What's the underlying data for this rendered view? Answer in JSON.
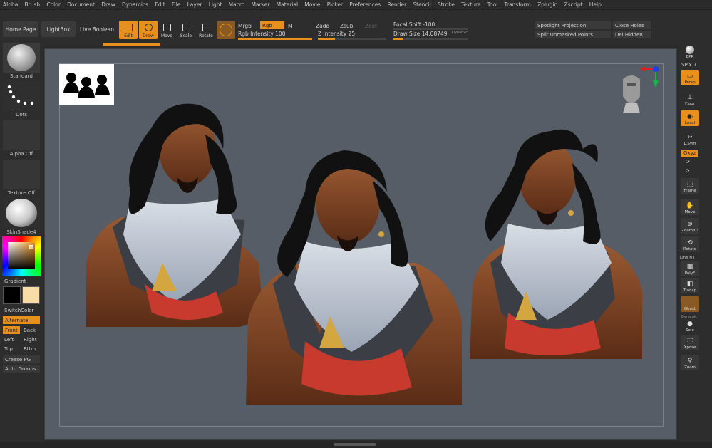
{
  "menu": [
    "Alpha",
    "Brush",
    "Color",
    "Document",
    "Draw",
    "Dynamics",
    "Edit",
    "File",
    "Layer",
    "Light",
    "Macro",
    "Marker",
    "Material",
    "Movie",
    "Picker",
    "Preferences",
    "Render",
    "Stencil",
    "Stroke",
    "Texture",
    "Tool",
    "Transform",
    "Zplugin",
    "Zscript",
    "Help"
  ],
  "toolbar": {
    "home_page": "Home Page",
    "lightbox": "LightBox",
    "live_boolean": "Live Boolean",
    "edit": "Edit",
    "draw": "Draw",
    "move": "Move",
    "scale": "Scale",
    "rotate": "Rotate",
    "mrgb": "Mrgb",
    "rgb": "Rgb",
    "m": "M",
    "rgb_intensity": "Rgb Intensity 100",
    "rgb_intensity_value": 1.0,
    "zadd": "Zadd",
    "zsub": "Zsub",
    "zcut": "Zcut",
    "z_intensity": "Z Intensity 25",
    "z_intensity_value": 0.25,
    "focal_shift": "Focal Shift -100",
    "draw_size": "Draw Size 14.08749",
    "dynamic": "Dynamic",
    "spotlight_projection": "Spotlight Projection",
    "split_unmasked_points": "Split Unmasked Points",
    "close_holes": "Close Holes",
    "del_hidden": "Del Hidden"
  },
  "left": {
    "brush": "Standard",
    "stroke": "Dots",
    "alpha": "Alpha Off",
    "texture": "Texture Off",
    "material": "SkinShade4",
    "gradient": "Gradient",
    "switch_color": "SwitchColor",
    "alternate": "Alternate",
    "front": "Front",
    "back": "Back",
    "left": "Left",
    "right": "Right",
    "top": "Top",
    "bottom": "Bttm",
    "crease_pg": "Crease PG",
    "auto_groups": "Auto Groups",
    "secondary_color": "#f7dca8",
    "primary_color": "#000000"
  },
  "right": {
    "bpr": "BPR",
    "spix": "SPix 7",
    "persp": "Persp",
    "floor": "Floor",
    "local": "Local",
    "lsym": "L.Sym",
    "xyz": "Qxyz",
    "frame": "Frame",
    "move": "Move",
    "zoom3d": "Zoom3D",
    "rotate": "Rotate",
    "line_fill": "Line Fill",
    "polyf": "PolyF",
    "transp": "Transp",
    "ghost": "Ghost",
    "dynamic": "Dynamic",
    "solo": "Solo",
    "xpose": "Xpose",
    "zoom": "Zoom"
  },
  "colors": {
    "accent": "#e8901d",
    "canvas": "#575d66",
    "panel": "#2d2d2d"
  }
}
